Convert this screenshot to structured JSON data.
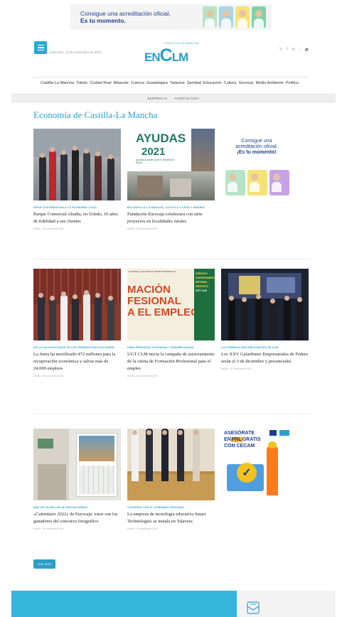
{
  "top_ad": {
    "line1": "Consigue una acreditación oficial.",
    "line2": "Es tu momento.",
    "face_colors": [
      "#b7e4c7",
      "#a8d5e6",
      "#f6e27a",
      "#7ed3a4"
    ]
  },
  "header": {
    "date": "miércoles, 10 de noviembre de 2021",
    "logo_sup": "CASTILLA-LA MANCHA",
    "logo_left": "EN",
    "logo_big": "C",
    "logo_right": "LM",
    "social": [
      "𝕏",
      "f",
      "in"
    ],
    "accent_color": "#2a9fca"
  },
  "nav": [
    "Castilla-La Mancha",
    "Toledo",
    "Ciudad Real",
    "Albacete",
    "Cuenca",
    "Guadalajara",
    "Talavera",
    "Sanidad",
    "Educación",
    "Cultura",
    "Sucesos",
    "Medio Ambiente",
    "Política"
  ],
  "subnav": [
    "EMPRESAS",
    "AGRICULTURA"
  ],
  "section_title": "Economía de Castilla-La Mancha",
  "articles": [
    {
      "kicker": "Gran contribución a la economía local",
      "title": "Parque Comercial Abadía, en Toledo, 10 años de fidelidad a sus clientes",
      "meta": "EnclM - 08 noviembre 2021"
    },
    {
      "kicker": "En Castilla-La Mancha, Castilla y León y Madrid",
      "title": "Fundación Eurocaja colaborará con siete proyectos en localidades rurales",
      "meta": "EnclM - 08 noviembre 2021"
    },
    {
      "kicker": "Así lo ha dicho Page en los premios Rais Solidaria",
      "title": "La Junta ha movilizado 472 millones para la recuperación económica y salvar más de 24.000 empleos",
      "meta": "EnclM - 08 noviembre 2021"
    },
    {
      "kicker": "Para personas ocupadas y desempleadas",
      "title": "UGT CLM inicia la campaña de asesoramiento de la oferta de Formación Profesional para el empleo",
      "meta": "EnclM - 08 noviembre 2021"
    },
    {
      "kicker": "Los premios más relevantes de CLM",
      "title": "Los XXV Galardones Empresariales de Fedeto serán el 3 de diciembre y presenciales",
      "meta": "EnclM - 07 noviembre 2021"
    },
    {
      "kicker": "Más de un millar de instantáneas",
      "title": "«Calendario 2022» de Eurocaja: estos son los ganadores del concurso fotográfico",
      "meta": "EnclM - 04 noviembre 2021"
    },
    {
      "kicker": "Convenio con el Gobierno regional",
      "title": "La empresa de tecnología educativa Smart Technologies se instala en Talavera",
      "meta": "EnclM - 04 noviembre 2021"
    }
  ],
  "image_texts": {
    "ayudas_title": "AYUDAS",
    "ayudas_year": "2021",
    "ayudas_sub": "Ayudas sociales para el Desarrollo Rural",
    "fp_top": "ACCEDE A LAS NUEVAS OPORTUNIDADES FP",
    "fp_big1": "MACIÓN",
    "fp_big2": "FESIONAL",
    "fp_big3": "A EL EMPLEO",
    "fp_side1": "SERVICIO",
    "fp_side2": "ASESORAMIENTO",
    "fp_side3": "INFORMA",
    "fp_side4": "GRATUITO",
    "fp_side5": "UGT CLM"
  },
  "side_ad": {
    "line1": "Consigue una",
    "line2": "acreditación oficial.",
    "line3": "¡Es tu momento!"
  },
  "cecam_ad": {
    "line1": "ASESÓRATE",
    "line2a": "EN",
    "line2b": "PRL",
    "line2c": "GRATIS",
    "line3": "CON CECAM"
  },
  "more_button": "VER MÁS"
}
